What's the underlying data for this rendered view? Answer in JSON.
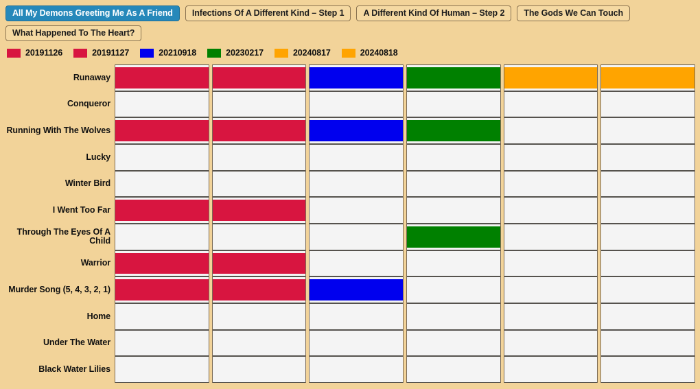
{
  "tabs": [
    {
      "label": "All My Demons Greeting Me As A Friend",
      "active": true
    },
    {
      "label": "Infections Of A Different Kind – Step 1",
      "active": false
    },
    {
      "label": "A Different Kind Of Human – Step 2",
      "active": false
    },
    {
      "label": "The Gods We Can Touch",
      "active": false
    },
    {
      "label": "What Happened To The Heart?",
      "active": false
    }
  ],
  "colors": {
    "background": "#f2d399",
    "active_tab": "#2688ba",
    "tab_background": "#f5d9a2",
    "tab_border": "#8a7350",
    "cell_empty": "#f4f4f4",
    "cell_border": "#55524d",
    "column_border": "#7a6a55",
    "crimson": "#d81540",
    "blue": "#0000ee",
    "green": "#008000",
    "orange": "#ffa400"
  },
  "chart_data": {
    "type": "heatmap",
    "title": "",
    "xlabel": "",
    "ylabel": "",
    "grid": true,
    "legend_position": "top-left",
    "legend": [
      {
        "label": "20191126",
        "color": "#d81540"
      },
      {
        "label": "20191127",
        "color": "#d81540"
      },
      {
        "label": "20210918",
        "color": "#0000ee"
      },
      {
        "label": "20230217",
        "color": "#008000"
      },
      {
        "label": "20240817",
        "color": "#ffa400"
      },
      {
        "label": "20240818",
        "color": "#ffa400"
      }
    ],
    "columns": [
      "20191126",
      "20191127",
      "20210918",
      "20230217",
      "20240817",
      "20240818"
    ],
    "categories": [
      "Runaway",
      "Conqueror",
      "Running With The Wolves",
      "Lucky",
      "Winter Bird",
      "I Went Too Far",
      "Through The Eyes Of A Child",
      "Warrior",
      "Murder Song (5, 4, 3, 2, 1)",
      "Home",
      "Under The Water",
      "Black Water Lilies"
    ],
    "cells": [
      [
        "#d81540",
        "#d81540",
        "#0000ee",
        "#008000",
        "#ffa400",
        "#ffa400"
      ],
      [
        null,
        null,
        null,
        null,
        null,
        null
      ],
      [
        "#d81540",
        "#d81540",
        "#0000ee",
        "#008000",
        null,
        null
      ],
      [
        null,
        null,
        null,
        null,
        null,
        null
      ],
      [
        null,
        null,
        null,
        null,
        null,
        null
      ],
      [
        "#d81540",
        "#d81540",
        null,
        null,
        null,
        null
      ],
      [
        null,
        null,
        null,
        "#008000",
        null,
        null
      ],
      [
        "#d81540",
        "#d81540",
        null,
        null,
        null,
        null
      ],
      [
        "#d81540",
        "#d81540",
        "#0000ee",
        null,
        null,
        null
      ],
      [
        null,
        null,
        null,
        null,
        null,
        null
      ],
      [
        null,
        null,
        null,
        null,
        null,
        null
      ],
      [
        null,
        null,
        null,
        null,
        null,
        null
      ]
    ]
  }
}
